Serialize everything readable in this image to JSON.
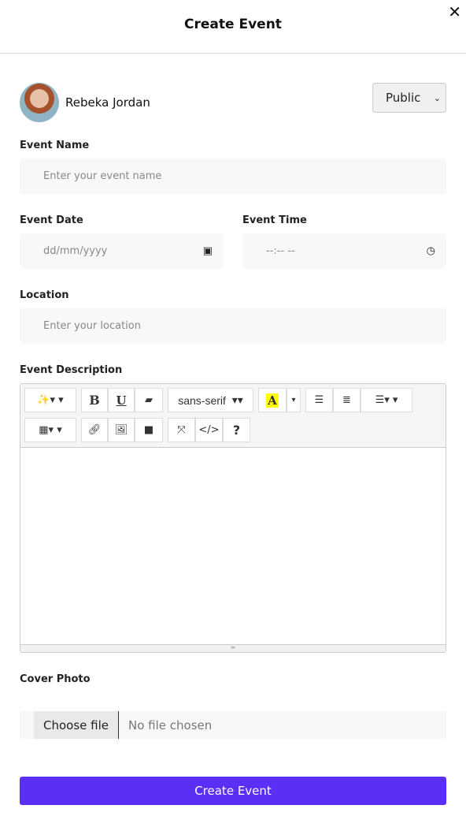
{
  "header": {
    "title": "Create Event",
    "close_icon": "close-icon"
  },
  "user": {
    "name": "Rebeka Jordan",
    "privacy": "Public"
  },
  "fields": {
    "event_name": {
      "label": "Event Name",
      "placeholder": "Enter your event name"
    },
    "event_date": {
      "label": "Event Date",
      "placeholder": "dd/mm/yyyy"
    },
    "event_time": {
      "label": "Event Time",
      "placeholder": "--:-- --"
    },
    "location": {
      "label": "Location",
      "placeholder": "Enter your location"
    },
    "description": {
      "label": "Event Description"
    },
    "cover_photo": {
      "label": "Cover Photo",
      "button": "Choose file",
      "status": "No file chosen"
    }
  },
  "toolbar": {
    "bold": "B",
    "underline": "U",
    "font": "sans-serif",
    "color": "A",
    "code": "</>",
    "help": "?"
  },
  "submit": "Create Event",
  "colors": {
    "accent": "#5b2ff5",
    "highlight": "#ffff00"
  }
}
